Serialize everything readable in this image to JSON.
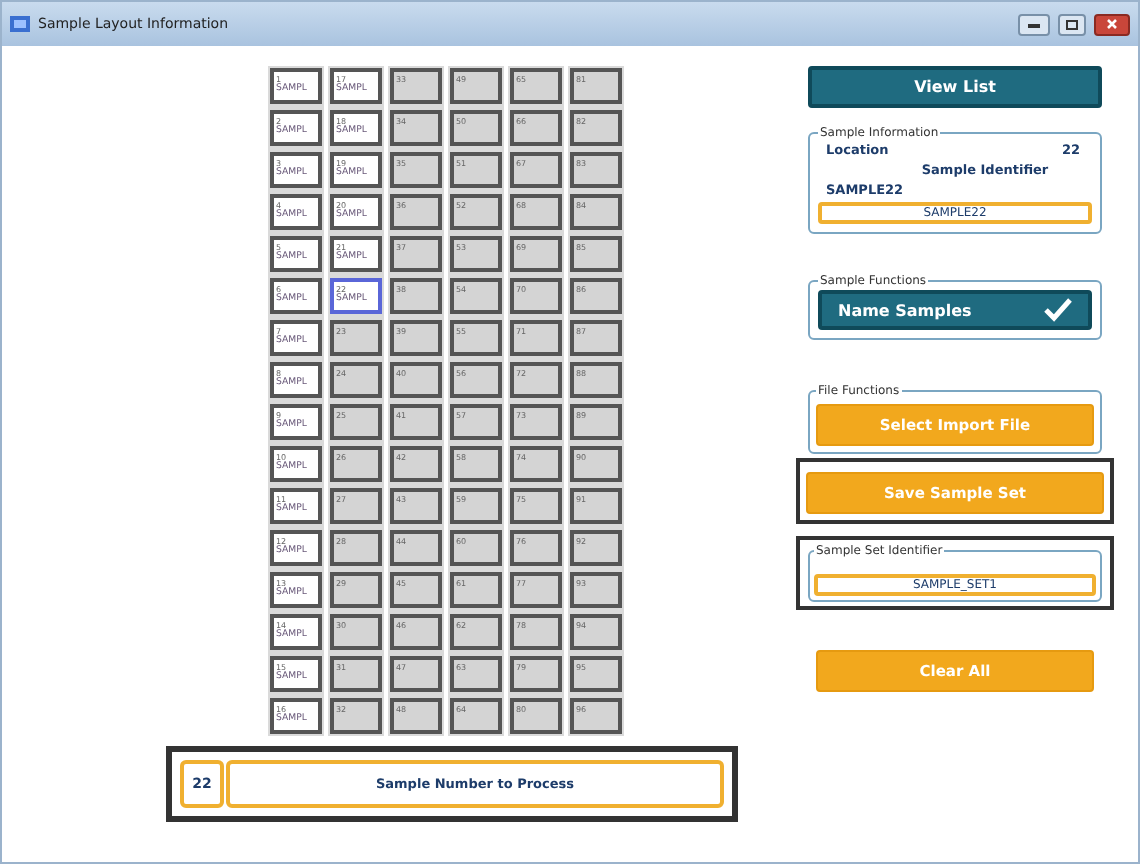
{
  "window": {
    "title": "Sample Layout Information"
  },
  "plate": {
    "columns": [
      {
        "wells": [
          {
            "number": "1",
            "name": "SAMPL",
            "kind": "named",
            "selected": false
          },
          {
            "number": "2",
            "name": "SAMPL",
            "kind": "named",
            "selected": false
          },
          {
            "number": "3",
            "name": "SAMPL",
            "kind": "named",
            "selected": false
          },
          {
            "number": "4",
            "name": "SAMPL",
            "kind": "named",
            "selected": false
          },
          {
            "number": "5",
            "name": "SAMPL",
            "kind": "named",
            "selected": false
          },
          {
            "number": "6",
            "name": "SAMPL",
            "kind": "named",
            "selected": false
          },
          {
            "number": "7",
            "name": "SAMPL",
            "kind": "named",
            "selected": false
          },
          {
            "number": "8",
            "name": "SAMPL",
            "kind": "named",
            "selected": false
          },
          {
            "number": "9",
            "name": "SAMPL",
            "kind": "named",
            "selected": false
          },
          {
            "number": "10",
            "name": "SAMPL",
            "kind": "named",
            "selected": false
          },
          {
            "number": "11",
            "name": "SAMPL",
            "kind": "named",
            "selected": false
          },
          {
            "number": "12",
            "name": "SAMPL",
            "kind": "named",
            "selected": false
          },
          {
            "number": "13",
            "name": "SAMPL",
            "kind": "named",
            "selected": false
          },
          {
            "number": "14",
            "name": "SAMPL",
            "kind": "named",
            "selected": false
          },
          {
            "number": "15",
            "name": "SAMPL",
            "kind": "named",
            "selected": false
          },
          {
            "number": "16",
            "name": "SAMPL",
            "kind": "named",
            "selected": false
          }
        ]
      },
      {
        "wells": [
          {
            "number": "17",
            "name": "SAMPL",
            "kind": "named",
            "selected": false
          },
          {
            "number": "18",
            "name": "SAMPL",
            "kind": "named",
            "selected": false
          },
          {
            "number": "19",
            "name": "SAMPL",
            "kind": "named",
            "selected": false
          },
          {
            "number": "20",
            "name": "SAMPL",
            "kind": "named",
            "selected": false
          },
          {
            "number": "21",
            "name": "SAMPL",
            "kind": "named",
            "selected": false
          },
          {
            "number": "22",
            "name": "SAMPL",
            "kind": "named",
            "selected": true
          },
          {
            "number": "23",
            "kind": "empty",
            "selected": false
          },
          {
            "number": "24",
            "kind": "empty",
            "selected": false
          },
          {
            "number": "25",
            "kind": "empty",
            "selected": false
          },
          {
            "number": "26",
            "kind": "empty",
            "selected": false
          },
          {
            "number": "27",
            "kind": "empty",
            "selected": false
          },
          {
            "number": "28",
            "kind": "empty",
            "selected": false
          },
          {
            "number": "29",
            "kind": "empty",
            "selected": false
          },
          {
            "number": "30",
            "kind": "empty",
            "selected": false
          },
          {
            "number": "31",
            "kind": "empty",
            "selected": false
          },
          {
            "number": "32",
            "kind": "empty",
            "selected": false
          }
        ]
      },
      {
        "wells": [
          {
            "number": "33",
            "kind": "empty",
            "selected": false
          },
          {
            "number": "34",
            "kind": "empty",
            "selected": false
          },
          {
            "number": "35",
            "kind": "empty",
            "selected": false
          },
          {
            "number": "36",
            "kind": "empty",
            "selected": false
          },
          {
            "number": "37",
            "kind": "empty",
            "selected": false
          },
          {
            "number": "38",
            "kind": "empty",
            "selected": false
          },
          {
            "number": "39",
            "kind": "empty",
            "selected": false
          },
          {
            "number": "40",
            "kind": "empty",
            "selected": false
          },
          {
            "number": "41",
            "kind": "empty",
            "selected": false
          },
          {
            "number": "42",
            "kind": "empty",
            "selected": false
          },
          {
            "number": "43",
            "kind": "empty",
            "selected": false
          },
          {
            "number": "44",
            "kind": "empty",
            "selected": false
          },
          {
            "number": "45",
            "kind": "empty",
            "selected": false
          },
          {
            "number": "46",
            "kind": "empty",
            "selected": false
          },
          {
            "number": "47",
            "kind": "empty",
            "selected": false
          },
          {
            "number": "48",
            "kind": "empty",
            "selected": false
          }
        ]
      },
      {
        "wells": [
          {
            "number": "49",
            "kind": "empty",
            "selected": false
          },
          {
            "number": "50",
            "kind": "empty",
            "selected": false
          },
          {
            "number": "51",
            "kind": "empty",
            "selected": false
          },
          {
            "number": "52",
            "kind": "empty",
            "selected": false
          },
          {
            "number": "53",
            "kind": "empty",
            "selected": false
          },
          {
            "number": "54",
            "kind": "empty",
            "selected": false
          },
          {
            "number": "55",
            "kind": "empty",
            "selected": false
          },
          {
            "number": "56",
            "kind": "empty",
            "selected": false
          },
          {
            "number": "57",
            "kind": "empty",
            "selected": false
          },
          {
            "number": "58",
            "kind": "empty",
            "selected": false
          },
          {
            "number": "59",
            "kind": "empty",
            "selected": false
          },
          {
            "number": "60",
            "kind": "empty",
            "selected": false
          },
          {
            "number": "61",
            "kind": "empty",
            "selected": false
          },
          {
            "number": "62",
            "kind": "empty",
            "selected": false
          },
          {
            "number": "63",
            "kind": "empty",
            "selected": false
          },
          {
            "number": "64",
            "kind": "empty",
            "selected": false
          }
        ]
      },
      {
        "wells": [
          {
            "number": "65",
            "kind": "empty",
            "selected": false
          },
          {
            "number": "66",
            "kind": "empty",
            "selected": false
          },
          {
            "number": "67",
            "kind": "empty",
            "selected": false
          },
          {
            "number": "68",
            "kind": "empty",
            "selected": false
          },
          {
            "number": "69",
            "kind": "empty",
            "selected": false
          },
          {
            "number": "70",
            "kind": "empty",
            "selected": false
          },
          {
            "number": "71",
            "kind": "empty",
            "selected": false
          },
          {
            "number": "72",
            "kind": "empty",
            "selected": false
          },
          {
            "number": "73",
            "kind": "empty",
            "selected": false
          },
          {
            "number": "74",
            "kind": "empty",
            "selected": false
          },
          {
            "number": "75",
            "kind": "empty",
            "selected": false
          },
          {
            "number": "76",
            "kind": "empty",
            "selected": false
          },
          {
            "number": "77",
            "kind": "empty",
            "selected": false
          },
          {
            "number": "78",
            "kind": "empty",
            "selected": false
          },
          {
            "number": "79",
            "kind": "empty",
            "selected": false
          },
          {
            "number": "80",
            "kind": "empty",
            "selected": false
          }
        ]
      },
      {
        "wells": [
          {
            "number": "81",
            "kind": "empty",
            "selected": false
          },
          {
            "number": "82",
            "kind": "empty",
            "selected": false
          },
          {
            "number": "83",
            "kind": "empty",
            "selected": false
          },
          {
            "number": "84",
            "kind": "empty",
            "selected": false
          },
          {
            "number": "85",
            "kind": "empty",
            "selected": false
          },
          {
            "number": "86",
            "kind": "empty",
            "selected": false
          },
          {
            "number": "87",
            "kind": "empty",
            "selected": false
          },
          {
            "number": "88",
            "kind": "empty",
            "selected": false
          },
          {
            "number": "89",
            "kind": "empty",
            "selected": false
          },
          {
            "number": "90",
            "kind": "empty",
            "selected": false
          },
          {
            "number": "91",
            "kind": "empty",
            "selected": false
          },
          {
            "number": "92",
            "kind": "empty",
            "selected": false
          },
          {
            "number": "93",
            "kind": "empty",
            "selected": false
          },
          {
            "number": "94",
            "kind": "empty",
            "selected": false
          },
          {
            "number": "95",
            "kind": "empty",
            "selected": false
          },
          {
            "number": "96",
            "kind": "empty",
            "selected": false
          }
        ]
      }
    ]
  },
  "process_bar": {
    "number": "22",
    "button": "Sample Number to Process",
    "highlighted": true
  },
  "view_list_button": "View List",
  "sample_information": {
    "title": "Sample Information",
    "location_label": "Location",
    "location_value": "22",
    "identifier_label": "Sample Identifier",
    "identifier_text": "SAMPLE22",
    "identifier_value": "SAMPLE22"
  },
  "sample_functions": {
    "title": "Sample Functions",
    "button": "Name Samples",
    "checked": true
  },
  "file_functions": {
    "title": "File Functions",
    "select_button": "Select Import File",
    "save_button": "Save Sample Set",
    "save_highlighted": true
  },
  "sample_set": {
    "title": "Sample Set Identifier",
    "value": "SAMPLE_SET1",
    "highlighted": true
  },
  "clear_button": "Clear All"
}
